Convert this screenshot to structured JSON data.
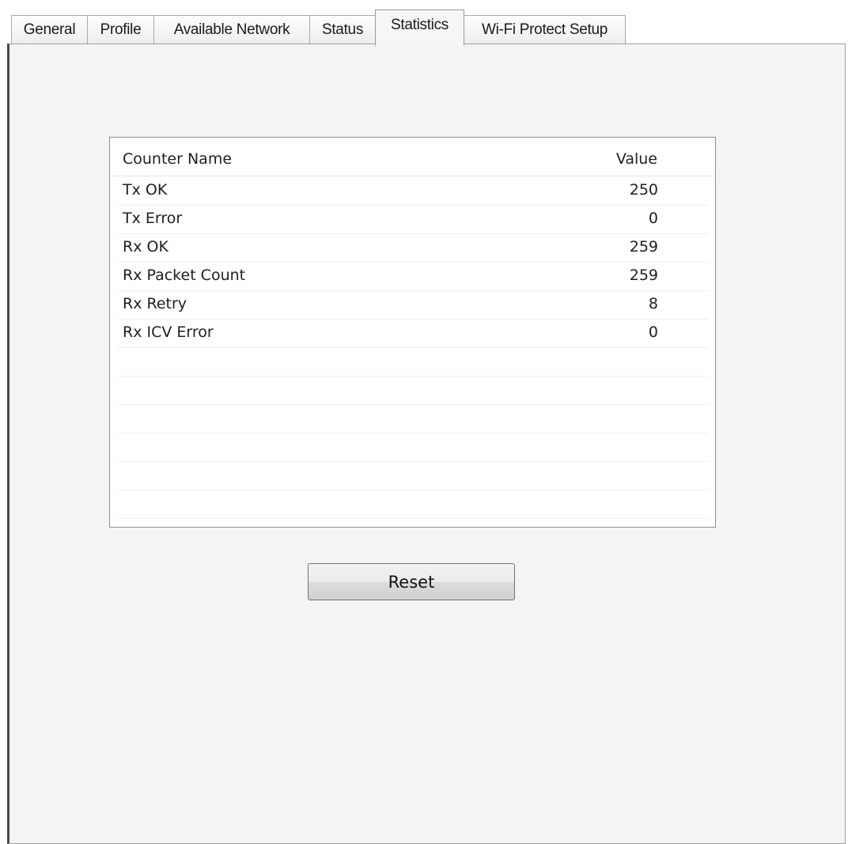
{
  "tabs": [
    {
      "label": "General",
      "active": false
    },
    {
      "label": "Profile",
      "active": false
    },
    {
      "label": "Available Network",
      "active": false
    },
    {
      "label": "Status",
      "active": false
    },
    {
      "label": "Statistics",
      "active": true
    },
    {
      "label": "Wi-Fi Protect Setup",
      "active": false
    }
  ],
  "statistics": {
    "columns": {
      "name": "Counter Name",
      "value": "Value"
    },
    "rows": [
      {
        "name": "Tx OK",
        "value": "250"
      },
      {
        "name": "Tx Error",
        "value": "0"
      },
      {
        "name": "Rx OK",
        "value": "259"
      },
      {
        "name": "Rx Packet Count",
        "value": "259"
      },
      {
        "name": "Rx Retry",
        "value": "8"
      },
      {
        "name": "Rx ICV Error",
        "value": "0"
      }
    ]
  },
  "buttons": {
    "reset_label": "Reset"
  }
}
